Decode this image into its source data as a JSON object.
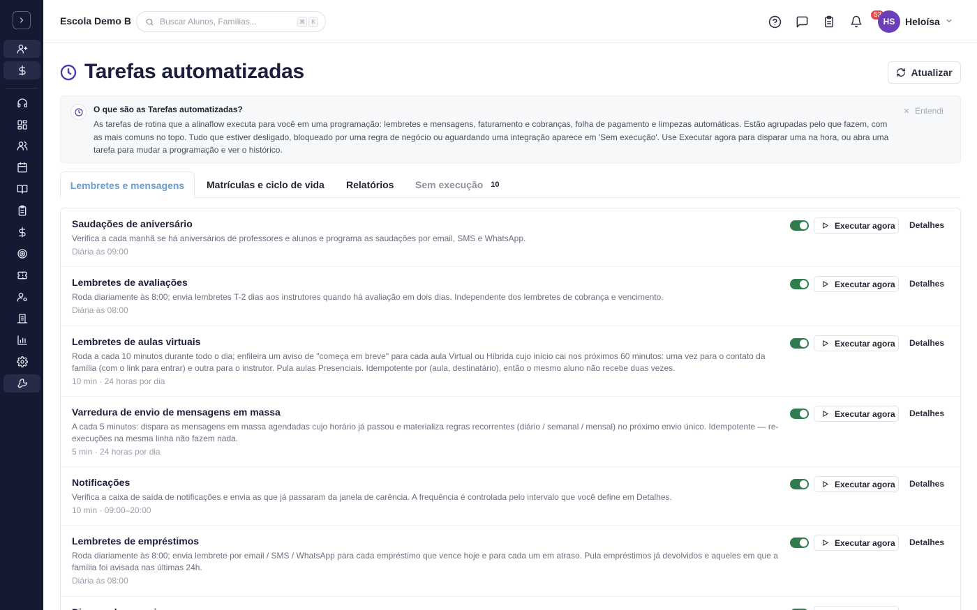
{
  "header": {
    "school_name": "Escola Demo B",
    "search_placeholder": "Buscar Alunos, Famílias...",
    "kbd_1": "⌘",
    "kbd_2": "K",
    "tasks_badge": "53",
    "user_initials": "HS",
    "user_name": "Heloísa"
  },
  "sidebar": {
    "items": [
      {
        "icon": "user-plus-icon"
      },
      {
        "icon": "dollar-icon"
      },
      {
        "icon": "headset-icon"
      },
      {
        "icon": "dashboard-icon"
      },
      {
        "icon": "users-icon"
      },
      {
        "icon": "calendar-icon"
      },
      {
        "icon": "book-icon"
      },
      {
        "icon": "clipboard-icon"
      },
      {
        "icon": "dollar-icon"
      },
      {
        "icon": "target-icon"
      },
      {
        "icon": "ticket-icon"
      },
      {
        "icon": "user-cog-icon"
      },
      {
        "icon": "building-icon"
      },
      {
        "icon": "bar-chart-icon"
      },
      {
        "icon": "gear-icon"
      },
      {
        "icon": "wrench-icon"
      }
    ]
  },
  "page": {
    "title": "Tarefas automatizadas",
    "refresh_label": "Atualizar"
  },
  "info": {
    "title": "O que são as Tarefas automatizadas?",
    "text": "As tarefas de rotina que a alinaflow executa para você em uma programação: lembretes e mensagens, faturamento e cobranças, folha de pagamento e limpezas automáticas. Estão agrupadas pelo que fazem, com as mais comuns no topo. Tudo que estiver desligado, bloqueado por uma regra de negócio ou aguardando uma integração aparece em 'Sem execução'. Use Executar agora para disparar uma na hora, ou abra uma tarefa para mudar a programação e ver o histórico.",
    "dismiss_label": "Entendi"
  },
  "tabs": [
    {
      "label": "Lembretes e mensagens"
    },
    {
      "label": "Matrículas e ciclo de vida"
    },
    {
      "label": "Relatórios"
    },
    {
      "label": "Sem execução",
      "count": "10"
    }
  ],
  "actions": {
    "run_label": "Executar agora",
    "details_label": "Detalhes"
  },
  "tasks": [
    {
      "title": "Saudações de aniversário",
      "description": "Verifica a cada manhã se há aniversários de professores e alunos e programa as saudações por email, SMS e WhatsApp.",
      "schedule": "Diária às 09:00",
      "enabled": true
    },
    {
      "title": "Lembretes de avaliações",
      "description": "Roda diariamente às 8:00; envia lembretes T-2 dias aos instrutores quando há avaliação em dois dias. Independente dos lembretes de cobrança e vencimento.",
      "schedule": "Diária às 08:00",
      "enabled": true
    },
    {
      "title": "Lembretes de aulas virtuais",
      "description": "Roda a cada 10 minutos durante todo o dia; enfileira um aviso de \"começa em breve\" para cada aula Virtual ou Híbrida cujo início cai nos próximos 60 minutos: uma vez para o contato da família (com o link para entrar) e outra para o instrutor. Pula aulas Presenciais. Idempotente por (aula, destinatário), então o mesmo aluno não recebe duas vezes.",
      "schedule": "10 min · 24 horas por dia",
      "enabled": true
    },
    {
      "title": "Varredura de envio de mensagens em massa",
      "description": "A cada 5 minutos: dispara as mensagens em massa agendadas cujo horário já passou e materializa regras recorrentes (diário / semanal / mensal) no próximo envio único. Idempotente — re-execuções na mesma linha não fazem nada.",
      "schedule": "5 min · 24 horas por dia",
      "enabled": true
    },
    {
      "title": "Notificações",
      "description": "Verifica a caixa de saída de notificações e envia as que já passaram da janela de carência. A frequência é controlada pelo intervalo que você define em Detalhes.",
      "schedule": "10 min · 09:00–20:00",
      "enabled": true
    },
    {
      "title": "Lembretes de empréstimos",
      "description": "Roda diariamente às 8:00; envia lembrete por email / SMS / WhatsApp para cada empréstimo que vence hoje e para cada um em atraso. Pula empréstimos já devolvidos e aqueles em que a família foi avisada nas últimas 24h.",
      "schedule": "Diária às 08:00",
      "enabled": true
    },
    {
      "title": "Disparo de pesquisas",
      "description": "",
      "schedule": "",
      "enabled": true
    }
  ],
  "colors": {
    "sidebar_bg": "#151a33",
    "toggle_on": "#2f7d4f",
    "active_tab": "#6d9ec9",
    "badge": "#e5484d",
    "avatar": "#6b3fb8"
  }
}
